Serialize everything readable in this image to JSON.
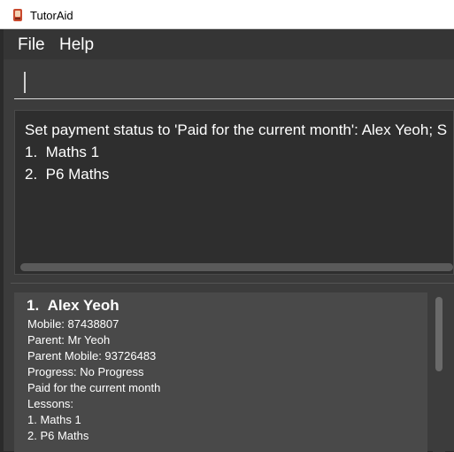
{
  "window": {
    "title": "TutorAid"
  },
  "menu": {
    "file": "File",
    "help": "Help"
  },
  "command_box": {
    "value": ""
  },
  "result": {
    "line1": "Set payment status to 'Paid for the current month': Alex Yeoh; S",
    "line2": "1.  Maths 1",
    "line3": "2.  P6 Maths"
  },
  "student": {
    "index": "1.",
    "name": "Alex Yeoh",
    "mobile": "Mobile: 87438807",
    "parent": "Parent: Mr Yeoh",
    "parent_mobile": "Parent Mobile: 93726483",
    "progress": "Progress: No Progress",
    "payment": "Paid for the current month",
    "lessons_label": "Lessons:",
    "lessons": [
      "1.  Maths 1",
      "2.  P6 Maths"
    ]
  },
  "colors": {
    "background": "#3c3c3c",
    "card": "#494949",
    "text": "#ffffff"
  }
}
